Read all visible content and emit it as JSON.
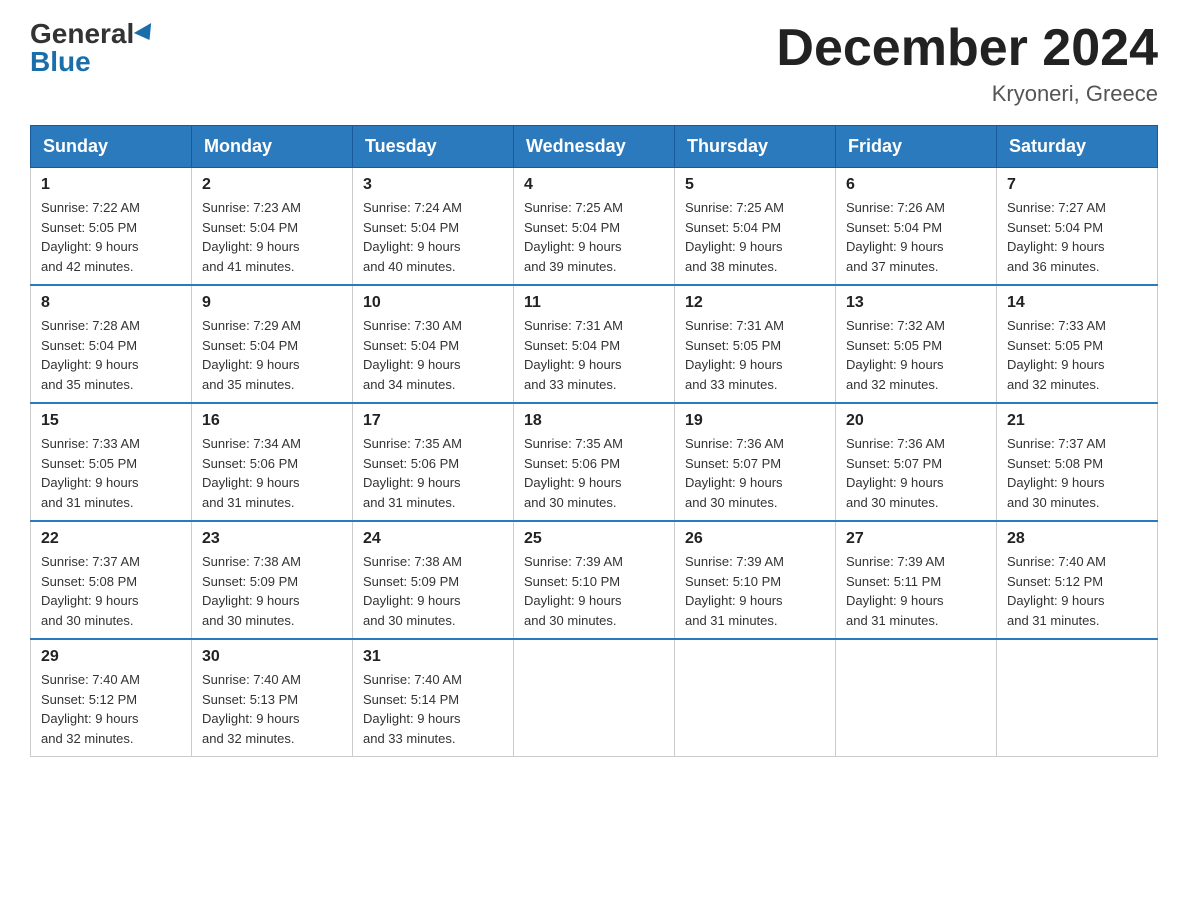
{
  "header": {
    "logo_general": "General",
    "logo_blue": "Blue",
    "month_title": "December 2024",
    "location": "Kryoneri, Greece"
  },
  "weekdays": [
    "Sunday",
    "Monday",
    "Tuesday",
    "Wednesday",
    "Thursday",
    "Friday",
    "Saturday"
  ],
  "weeks": [
    [
      {
        "day": "1",
        "sunrise": "7:22 AM",
        "sunset": "5:05 PM",
        "daylight": "9 hours and 42 minutes."
      },
      {
        "day": "2",
        "sunrise": "7:23 AM",
        "sunset": "5:04 PM",
        "daylight": "9 hours and 41 minutes."
      },
      {
        "day": "3",
        "sunrise": "7:24 AM",
        "sunset": "5:04 PM",
        "daylight": "9 hours and 40 minutes."
      },
      {
        "day": "4",
        "sunrise": "7:25 AM",
        "sunset": "5:04 PM",
        "daylight": "9 hours and 39 minutes."
      },
      {
        "day": "5",
        "sunrise": "7:25 AM",
        "sunset": "5:04 PM",
        "daylight": "9 hours and 38 minutes."
      },
      {
        "day": "6",
        "sunrise": "7:26 AM",
        "sunset": "5:04 PM",
        "daylight": "9 hours and 37 minutes."
      },
      {
        "day": "7",
        "sunrise": "7:27 AM",
        "sunset": "5:04 PM",
        "daylight": "9 hours and 36 minutes."
      }
    ],
    [
      {
        "day": "8",
        "sunrise": "7:28 AM",
        "sunset": "5:04 PM",
        "daylight": "9 hours and 35 minutes."
      },
      {
        "day": "9",
        "sunrise": "7:29 AM",
        "sunset": "5:04 PM",
        "daylight": "9 hours and 35 minutes."
      },
      {
        "day": "10",
        "sunrise": "7:30 AM",
        "sunset": "5:04 PM",
        "daylight": "9 hours and 34 minutes."
      },
      {
        "day": "11",
        "sunrise": "7:31 AM",
        "sunset": "5:04 PM",
        "daylight": "9 hours and 33 minutes."
      },
      {
        "day": "12",
        "sunrise": "7:31 AM",
        "sunset": "5:05 PM",
        "daylight": "9 hours and 33 minutes."
      },
      {
        "day": "13",
        "sunrise": "7:32 AM",
        "sunset": "5:05 PM",
        "daylight": "9 hours and 32 minutes."
      },
      {
        "day": "14",
        "sunrise": "7:33 AM",
        "sunset": "5:05 PM",
        "daylight": "9 hours and 32 minutes."
      }
    ],
    [
      {
        "day": "15",
        "sunrise": "7:33 AM",
        "sunset": "5:05 PM",
        "daylight": "9 hours and 31 minutes."
      },
      {
        "day": "16",
        "sunrise": "7:34 AM",
        "sunset": "5:06 PM",
        "daylight": "9 hours and 31 minutes."
      },
      {
        "day": "17",
        "sunrise": "7:35 AM",
        "sunset": "5:06 PM",
        "daylight": "9 hours and 31 minutes."
      },
      {
        "day": "18",
        "sunrise": "7:35 AM",
        "sunset": "5:06 PM",
        "daylight": "9 hours and 30 minutes."
      },
      {
        "day": "19",
        "sunrise": "7:36 AM",
        "sunset": "5:07 PM",
        "daylight": "9 hours and 30 minutes."
      },
      {
        "day": "20",
        "sunrise": "7:36 AM",
        "sunset": "5:07 PM",
        "daylight": "9 hours and 30 minutes."
      },
      {
        "day": "21",
        "sunrise": "7:37 AM",
        "sunset": "5:08 PM",
        "daylight": "9 hours and 30 minutes."
      }
    ],
    [
      {
        "day": "22",
        "sunrise": "7:37 AM",
        "sunset": "5:08 PM",
        "daylight": "9 hours and 30 minutes."
      },
      {
        "day": "23",
        "sunrise": "7:38 AM",
        "sunset": "5:09 PM",
        "daylight": "9 hours and 30 minutes."
      },
      {
        "day": "24",
        "sunrise": "7:38 AM",
        "sunset": "5:09 PM",
        "daylight": "9 hours and 30 minutes."
      },
      {
        "day": "25",
        "sunrise": "7:39 AM",
        "sunset": "5:10 PM",
        "daylight": "9 hours and 30 minutes."
      },
      {
        "day": "26",
        "sunrise": "7:39 AM",
        "sunset": "5:10 PM",
        "daylight": "9 hours and 31 minutes."
      },
      {
        "day": "27",
        "sunrise": "7:39 AM",
        "sunset": "5:11 PM",
        "daylight": "9 hours and 31 minutes."
      },
      {
        "day": "28",
        "sunrise": "7:40 AM",
        "sunset": "5:12 PM",
        "daylight": "9 hours and 31 minutes."
      }
    ],
    [
      {
        "day": "29",
        "sunrise": "7:40 AM",
        "sunset": "5:12 PM",
        "daylight": "9 hours and 32 minutes."
      },
      {
        "day": "30",
        "sunrise": "7:40 AM",
        "sunset": "5:13 PM",
        "daylight": "9 hours and 32 minutes."
      },
      {
        "day": "31",
        "sunrise": "7:40 AM",
        "sunset": "5:14 PM",
        "daylight": "9 hours and 33 minutes."
      },
      null,
      null,
      null,
      null
    ]
  ],
  "labels": {
    "sunrise": "Sunrise:",
    "sunset": "Sunset:",
    "daylight": "Daylight:"
  }
}
